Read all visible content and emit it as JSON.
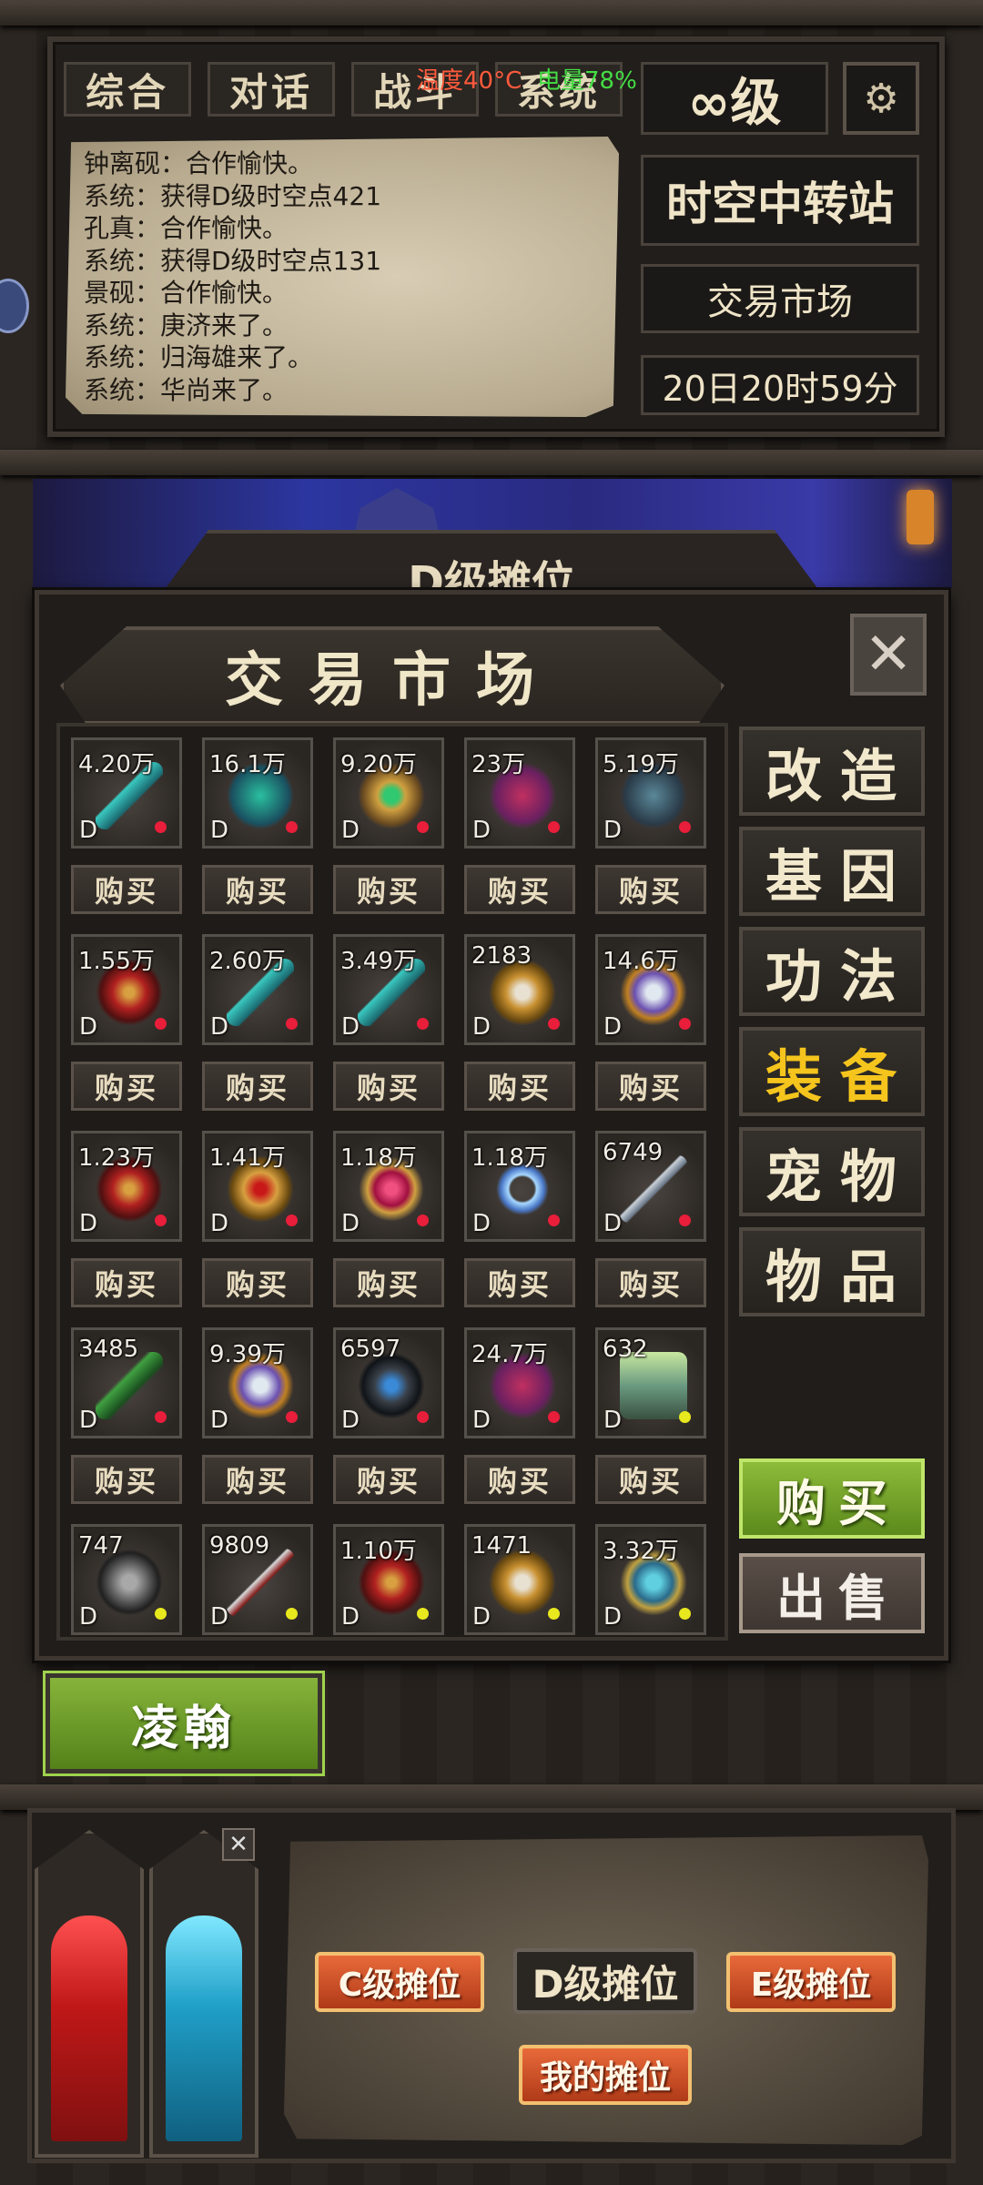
{
  "tabs": [
    "综合",
    "对话",
    "战斗",
    "系统"
  ],
  "status": {
    "temperature": "温度40°C",
    "battery": "电量78%"
  },
  "level": "∞级",
  "chat": [
    "钟离砚：合作愉快。",
    "系统：获得D级时空点421",
    "孔真：合作愉快。",
    "系统：获得D级时空点131",
    "景砚：合作愉快。",
    "系统：庚济来了。",
    "系统：归海雄来了。",
    "系统：华尚来了。"
  ],
  "location": {
    "station": "时空中转站",
    "place": "交易市场",
    "time": "20日20时59分"
  },
  "banner": {
    "label": "D级摊位"
  },
  "market": {
    "title": "交易市场",
    "close_icon": "close-icon",
    "items": [
      {
        "price": "4.20万",
        "grade": "D",
        "dot": "#e81e3a",
        "icon": "jade-sword-icon"
      },
      {
        "price": "16.1万",
        "grade": "D",
        "dot": "#e81e3a",
        "icon": "jade-gauntlet-icon"
      },
      {
        "price": "9.20万",
        "grade": "D",
        "dot": "#e81e3a",
        "icon": "gold-pendant-icon"
      },
      {
        "price": "23万",
        "grade": "D",
        "dot": "#e81e3a",
        "icon": "crimson-bracer-icon"
      },
      {
        "price": "5.19万",
        "grade": "D",
        "dot": "#e81e3a",
        "icon": "claw-glove-icon"
      },
      {
        "price": "1.55万",
        "grade": "D",
        "dot": "#e81e3a",
        "icon": "red-belt-icon"
      },
      {
        "price": "2.60万",
        "grade": "D",
        "dot": "#e81e3a",
        "icon": "jade-sword-icon"
      },
      {
        "price": "3.49万",
        "grade": "D",
        "dot": "#e81e3a",
        "icon": "jade-sword-icon"
      },
      {
        "price": "2183",
        "grade": "D",
        "dot": "#e81e3a",
        "icon": "gold-ring-icon"
      },
      {
        "price": "14.6万",
        "grade": "D",
        "dot": "#e81e3a",
        "icon": "crystal-gauntlet-icon"
      },
      {
        "price": "1.23万",
        "grade": "D",
        "dot": "#e81e3a",
        "icon": "red-belt-icon"
      },
      {
        "price": "1.41万",
        "grade": "D",
        "dot": "#e81e3a",
        "icon": "gold-helmet-icon"
      },
      {
        "price": "1.18万",
        "grade": "D",
        "dot": "#e81e3a",
        "icon": "ruby-armor-icon"
      },
      {
        "price": "1.18万",
        "grade": "D",
        "dot": "#e81e3a",
        "icon": "chain-necklace-icon"
      },
      {
        "price": "6749",
        "grade": "D",
        "dot": "#e81e3a",
        "icon": "steel-sword-icon"
      },
      {
        "price": "3485",
        "grade": "D",
        "dot": "#e81e3a",
        "icon": "green-blade-icon"
      },
      {
        "price": "9.39万",
        "grade": "D",
        "dot": "#e81e3a",
        "icon": "crystal-gauntlet-icon"
      },
      {
        "price": "6597",
        "grade": "D",
        "dot": "#e81e3a",
        "icon": "dark-helmet-icon"
      },
      {
        "price": "24.7万",
        "grade": "D",
        "dot": "#e81e3a",
        "icon": "crimson-bracer-icon"
      },
      {
        "price": "632",
        "grade": "D",
        "dot": "#e8e81e",
        "icon": "cloth-robe-icon"
      },
      {
        "price": "747",
        "grade": "D",
        "dot": "#e8e81e",
        "icon": "iron-boots-icon"
      },
      {
        "price": "9809",
        "grade": "D",
        "dot": "#e8e81e",
        "icon": "red-sword-icon"
      },
      {
        "price": "1.10万",
        "grade": "D",
        "dot": "#e8e81e",
        "icon": "red-belt-icon"
      },
      {
        "price": "1471",
        "grade": "D",
        "dot": "#e8e81e",
        "icon": "gold-ring-icon"
      },
      {
        "price": "3.32万",
        "grade": "D",
        "dot": "#e8e81e",
        "icon": "teal-bracer-icon"
      }
    ],
    "buy_label": "购买",
    "categories": [
      "改造",
      "基因",
      "功法",
      "装备",
      "宠物",
      "物品"
    ],
    "active_category": "装备",
    "buy_button": "购买",
    "sell_button": "出售"
  },
  "player_name": "凌翰",
  "bottom": {
    "grades": [
      "C级摊位",
      "D级摊位",
      "E级摊位"
    ],
    "active_grade": "D级摊位",
    "my_stall": "我的摊位"
  }
}
